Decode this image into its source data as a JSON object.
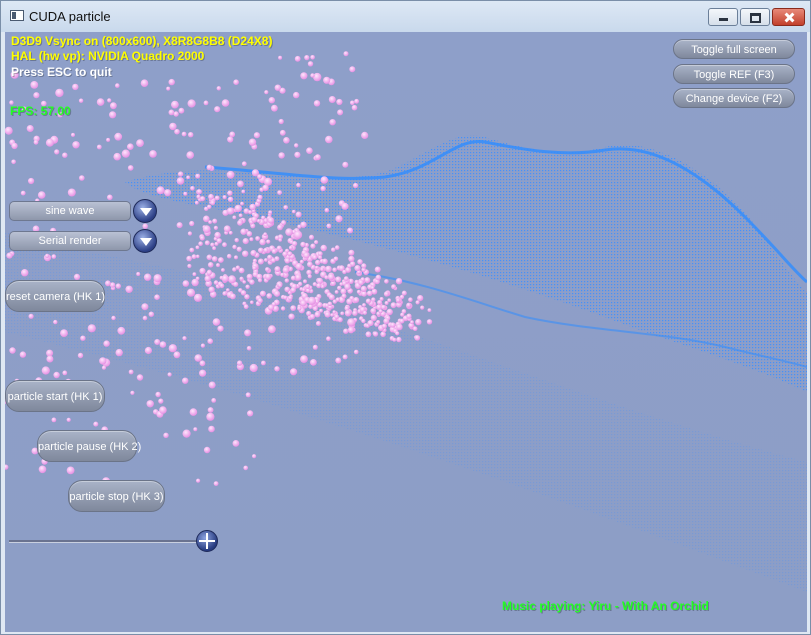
{
  "window": {
    "title": "CUDA particle",
    "controls": {
      "minimize": "minimize",
      "maximize": "maximize",
      "close": "close"
    }
  },
  "hud": {
    "line1": "D3D9 Vsync on (800x600), X8R8G8B8 (D24X8)",
    "line2": "HAL (hw vp): NVIDIA Quadro 2000",
    "line3": "Press ESC to quit",
    "fps": "FPS: 57.00",
    "music": "Music playing: Yiru - With An Orchid"
  },
  "top_buttons": {
    "toggle_full_screen": "Toggle full screen",
    "toggle_ref": "Toggle REF (F3)",
    "change_device": "Change device (F2)"
  },
  "controls": {
    "wave_select": {
      "value": "sine wave"
    },
    "render_select": {
      "value": "Serial render"
    },
    "reset_camera": "reset camera (HK 1)",
    "particle_start": "particle start (HK 1)",
    "particle_pause": "particle pause (HK 2)",
    "particle_stop": "particle stop (HK 3)",
    "slider_level": 1.0
  },
  "colors": {
    "background": "#8e9fc9",
    "mesh": "#2f8cff",
    "particles": "#f2a6ee",
    "hud_yellow": "#ffff00",
    "hud_green": "#22ff22"
  }
}
